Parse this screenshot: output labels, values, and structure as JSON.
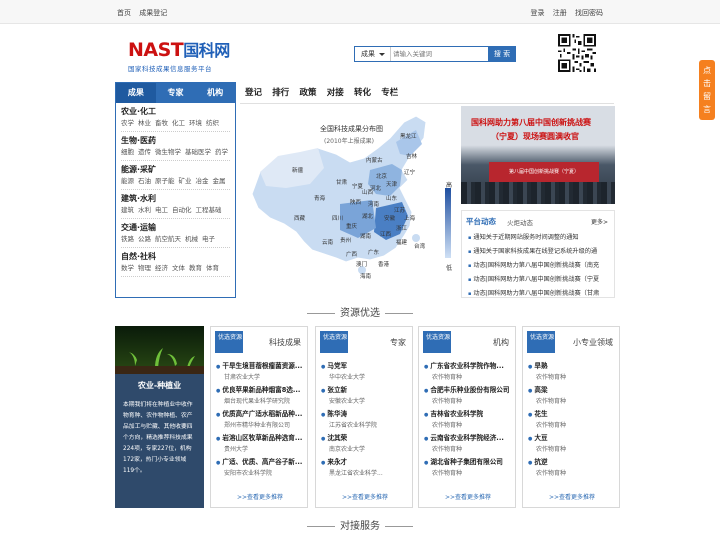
{
  "topbar": {
    "home": "首页",
    "register": "成果登记",
    "login": "登录",
    "signup": "注册",
    "recover": "找回密码"
  },
  "logo": {
    "latin": "NAST",
    "cn": "国科网",
    "subtitle": "国家科技成果信息服务平台"
  },
  "search": {
    "category": "成果",
    "placeholder": "请输入关键词",
    "button": "搜 索"
  },
  "float_button": "点击留言",
  "categories": {
    "tabs": [
      "成果",
      "专家",
      "机构"
    ],
    "groups": [
      {
        "title": "农业·化工",
        "items": [
          "农学",
          "林业",
          "畜牧",
          "化工",
          "环境",
          "纺织"
        ]
      },
      {
        "title": "生物·医药",
        "items": [
          "细胞",
          "遗传",
          "微生物学",
          "基础医学",
          "药学"
        ]
      },
      {
        "title": "能源·采矿",
        "items": [
          "能源",
          "石油",
          "原子能",
          "矿业",
          "冶金",
          "金属"
        ]
      },
      {
        "title": "建筑·水利",
        "items": [
          "建筑",
          "水利",
          "电工",
          "自动化",
          "工程基础"
        ]
      },
      {
        "title": "交通·运输",
        "items": [
          "铁路",
          "公路",
          "航空航天",
          "机械",
          "电子"
        ]
      },
      {
        "title": "自然·社科",
        "items": [
          "数学",
          "物理",
          "经济",
          "文体",
          "教育",
          "体育"
        ]
      }
    ]
  },
  "nav": [
    "登记",
    "排行",
    "政策",
    "对接",
    "转化",
    "专栏"
  ],
  "map": {
    "title": "全国科技成果分布图",
    "subtitle": "(2010年上报成果)",
    "legend_high": "高",
    "legend_low": "低",
    "labels": [
      "黑龙江",
      "吉林",
      "内蒙古",
      "辽宁",
      "北京",
      "天津",
      "河北",
      "新疆",
      "甘肃",
      "宁夏",
      "山西",
      "山东",
      "青海",
      "陕西",
      "河南",
      "江苏",
      "西藏",
      "四川",
      "湖北",
      "安徽",
      "上海",
      "重庆",
      "浙江",
      "云南",
      "贵州",
      "湖南",
      "江西",
      "福建",
      "台湾",
      "广西",
      "广东",
      "香港",
      "澳门",
      "海南"
    ]
  },
  "photo": {
    "headline": "国科网助力第八届中国创新挑战赛",
    "headline2": "（宁夏）现场赛圆满收官",
    "banner": "第八届中国创新挑战赛（宁夏）"
  },
  "news": {
    "title": "平台动态",
    "subtitle": "火炬动态",
    "more": "更多>",
    "items": [
      "通知关于近期网站服务时间调整的通知",
      "通知关于国家科技成果在线登记系统升级的通",
      "动态|国科网助力第八届中国创新挑战赛（南充",
      "动态|国科网助力第八届中国创新挑战赛（宁夏",
      "动态|国科网助力第八届中国创新挑战赛（甘肃"
    ]
  },
  "sections": {
    "resources": "资源优选",
    "matching": "对接服务"
  },
  "promo": {
    "title": "农业-种植业",
    "text": "本期我们将在种植业中收作物育种、农作物种植、农产品加工与贮藏、其他收要四个方向，精选推荐科技成果224项，专家227位，机构172家，热门小专业领域119个。"
  },
  "resource_cards": [
    {
      "badge": "优选资源",
      "title": "科技成果",
      "items": [
        {
          "name": "干旱生境苜蓿根瘤菌资源...",
          "org": "甘肃农业大学"
        },
        {
          "name": "优良苹果新品种烟富8选...",
          "org": "烟台现代果业科学研究院"
        },
        {
          "name": "优质高产广适水稻新品种...",
          "org": "郑州市精华种业有限公司"
        },
        {
          "name": "岩溶山区牧草新品种选育...",
          "org": "贵州大学"
        },
        {
          "name": "广适、优质、高产谷子新...",
          "org": "安阳市农业科学院"
        }
      ],
      "more": ">>查看更多推荐"
    },
    {
      "badge": "优选资源",
      "title": "专家",
      "items": [
        {
          "name": "马党军",
          "org": "华中农业大学"
        },
        {
          "name": "张立新",
          "org": "安徽农业大学"
        },
        {
          "name": "陈华涛",
          "org": "江苏省农业科学院"
        },
        {
          "name": "沈其荣",
          "org": "南京农业大学"
        },
        {
          "name": "来永才",
          "org": "黑龙江省农业科学..."
        }
      ],
      "more": ">>查看更多推荐"
    },
    {
      "badge": "优选资源",
      "title": "机构",
      "items": [
        {
          "name": "广东省农业科学院作物...",
          "org": "农作物育种"
        },
        {
          "name": "合肥丰乐种业股份有限公司",
          "org": "农作物育种"
        },
        {
          "name": "吉林省农业科学院",
          "org": "农作物育种"
        },
        {
          "name": "云南省农业科学院经济...",
          "org": "农作物育种"
        },
        {
          "name": "湖北省种子集团有限公司",
          "org": "农作物育种"
        }
      ],
      "more": ">>查看更多推荐"
    },
    {
      "badge": "优选资源",
      "title": "小专业领域",
      "items": [
        {
          "name": "旱熟",
          "org": "农作物育种"
        },
        {
          "name": "高梁",
          "org": "农作物育种"
        },
        {
          "name": "花生",
          "org": "农作物育种"
        },
        {
          "name": "大豆",
          "org": "农作物育种"
        },
        {
          "name": "抗逆",
          "org": "农作物育种"
        }
      ],
      "more": ">>查看更多推荐"
    }
  ],
  "colors": {
    "primary": "#2f6db5",
    "brand_red": "#cc1111",
    "accent_orange": "#f5801f"
  }
}
